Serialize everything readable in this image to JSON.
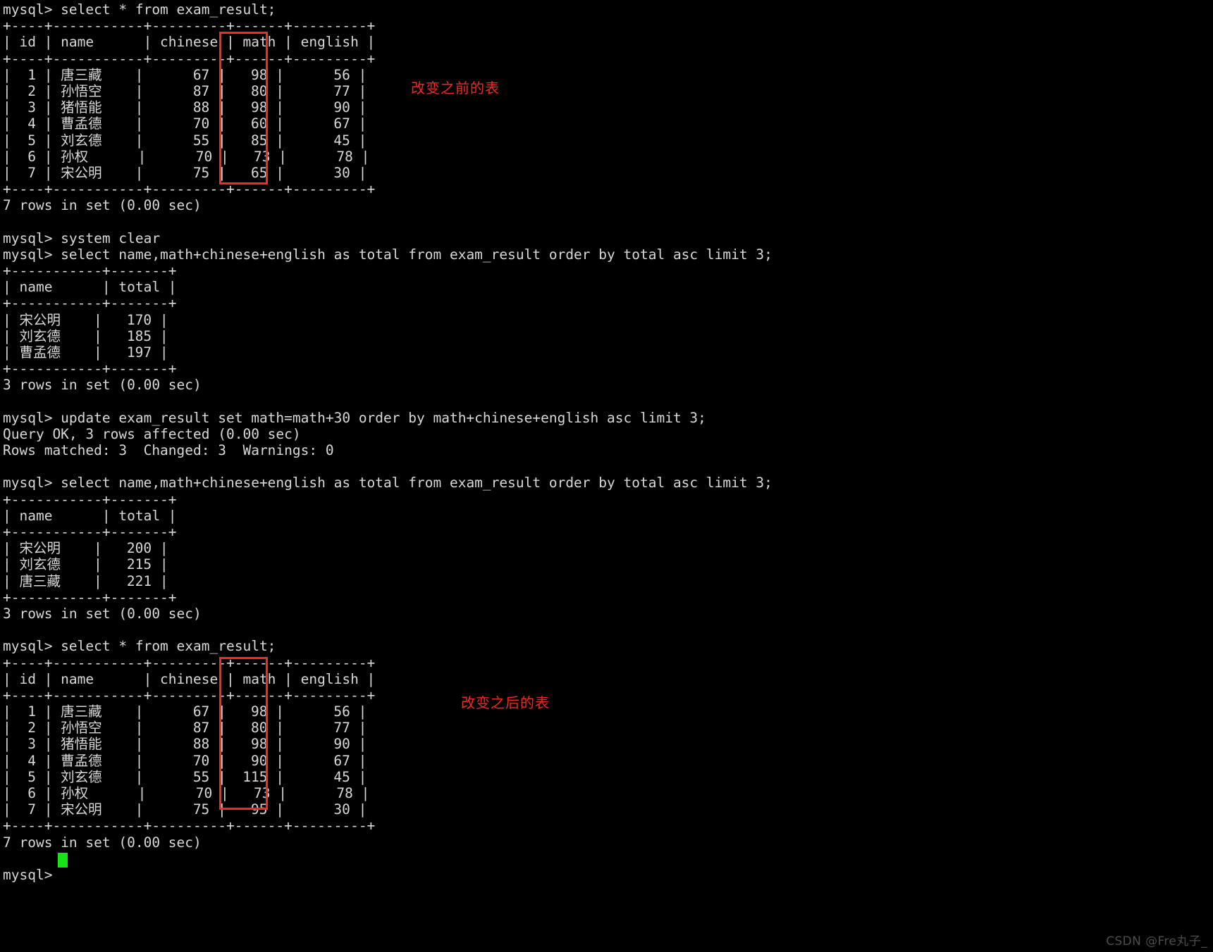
{
  "terminal": {
    "prompt": "mysql>",
    "background_color": "#000000",
    "text_color": "#d8d8d8",
    "cursor_color": "#18e218",
    "annotation_color": "#ef2a22",
    "lines": [
      "mysql> select * from exam_result;",
      "+----+-----------+---------+------+---------+",
      "| id | name      | chinese | math | english |",
      "+----+-----------+---------+------+---------+",
      "|  1 | 唐三藏    |      67 |   98 |      56 |",
      "|  2 | 孙悟空    |      87 |   80 |      77 |",
      "|  3 | 猪悟能    |      88 |   98 |      90 |",
      "|  4 | 曹孟德    |      70 |   60 |      67 |",
      "|  5 | 刘玄德    |      55 |   85 |      45 |",
      "|  6 | 孙权      |      70 |   73 |      78 |",
      "|  7 | 宋公明    |      75 |   65 |      30 |",
      "+----+-----------+---------+------+---------+",
      "7 rows in set (0.00 sec)",
      "",
      "mysql> system clear",
      "mysql> select name,math+chinese+english as total from exam_result order by total asc limit 3;",
      "+-----------+-------+",
      "| name      | total |",
      "+-----------+-------+",
      "| 宋公明    |   170 |",
      "| 刘玄德    |   185 |",
      "| 曹孟德    |   197 |",
      "+-----------+-------+",
      "3 rows in set (0.00 sec)",
      "",
      "mysql> update exam_result set math=math+30 order by math+chinese+english asc limit 3;",
      "Query OK, 3 rows affected (0.00 sec)",
      "Rows matched: 3  Changed: 3  Warnings: 0",
      "",
      "mysql> select name,math+chinese+english as total from exam_result order by total asc limit 3;",
      "+-----------+-------+",
      "| name      | total |",
      "+-----------+-------+",
      "| 宋公明    |   200 |",
      "| 刘玄德    |   215 |",
      "| 唐三藏    |   221 |",
      "+-----------+-------+",
      "3 rows in set (0.00 sec)",
      "",
      "mysql> select * from exam_result;",
      "+----+-----------+---------+------+---------+",
      "| id | name      | chinese | math | english |",
      "+----+-----------+---------+------+---------+",
      "|  1 | 唐三藏    |      67 |   98 |      56 |",
      "|  2 | 孙悟空    |      87 |   80 |      77 |",
      "|  3 | 猪悟能    |      88 |   98 |      90 |",
      "|  4 | 曹孟德    |      70 |   90 |      67 |",
      "|  5 | 刘玄德    |      55 |  115 |      45 |",
      "|  6 | 孙权      |      70 |   73 |      78 |",
      "|  7 | 宋公明    |      75 |   95 |      30 |",
      "+----+-----------+---------+------+---------+",
      "7 rows in set (0.00 sec)",
      "",
      "mysql> "
    ]
  },
  "annotations": {
    "before_label": "改变之前的表",
    "after_label": "改变之后的表"
  },
  "watermark": {
    "text": "CSDN @Fre丸子_"
  },
  "tables": {
    "exam_result_before": {
      "columns": [
        "id",
        "name",
        "chinese",
        "math",
        "english"
      ],
      "rows": [
        [
          1,
          "唐三藏",
          67,
          98,
          56
        ],
        [
          2,
          "孙悟空",
          87,
          80,
          77
        ],
        [
          3,
          "猪悟能",
          88,
          98,
          90
        ],
        [
          4,
          "曹孟德",
          70,
          60,
          67
        ],
        [
          5,
          "刘玄德",
          55,
          85,
          45
        ],
        [
          6,
          "孙权",
          70,
          73,
          78
        ],
        [
          7,
          "宋公明",
          75,
          65,
          30
        ]
      ],
      "footer": "7 rows in set (0.00 sec)"
    },
    "totals_before": {
      "columns": [
        "name",
        "total"
      ],
      "rows": [
        [
          "宋公明",
          170
        ],
        [
          "刘玄德",
          185
        ],
        [
          "曹孟德",
          197
        ]
      ],
      "footer": "3 rows in set (0.00 sec)"
    },
    "totals_after": {
      "columns": [
        "name",
        "total"
      ],
      "rows": [
        [
          "宋公明",
          200
        ],
        [
          "刘玄德",
          215
        ],
        [
          "唐三藏",
          221
        ]
      ],
      "footer": "3 rows in set (0.00 sec)"
    },
    "exam_result_after": {
      "columns": [
        "id",
        "name",
        "chinese",
        "math",
        "english"
      ],
      "rows": [
        [
          1,
          "唐三藏",
          67,
          98,
          56
        ],
        [
          2,
          "孙悟空",
          87,
          80,
          77
        ],
        [
          3,
          "猪悟能",
          88,
          98,
          90
        ],
        [
          4,
          "曹孟德",
          70,
          90,
          67
        ],
        [
          5,
          "刘玄德",
          55,
          115,
          45
        ],
        [
          6,
          "孙权",
          70,
          73,
          78
        ],
        [
          7,
          "宋公明",
          75,
          95,
          30
        ]
      ],
      "footer": "7 rows in set (0.00 sec)"
    }
  },
  "statements": {
    "select_all_1": "select * from exam_result;",
    "system_clear": "system clear",
    "select_total_asc_1": "select name,math+chinese+english as total from exam_result order by total asc limit 3;",
    "update_math": "update exam_result set math=math+30 order by math+chinese+english asc limit 3;",
    "query_ok": "Query OK, 3 rows affected (0.00 sec)",
    "rows_matched": "Rows matched: 3  Changed: 3  Warnings: 0",
    "select_total_asc_2": "select name,math+chinese+english as total from exam_result order by total asc limit 3;",
    "select_all_2": "select * from exam_result;"
  }
}
